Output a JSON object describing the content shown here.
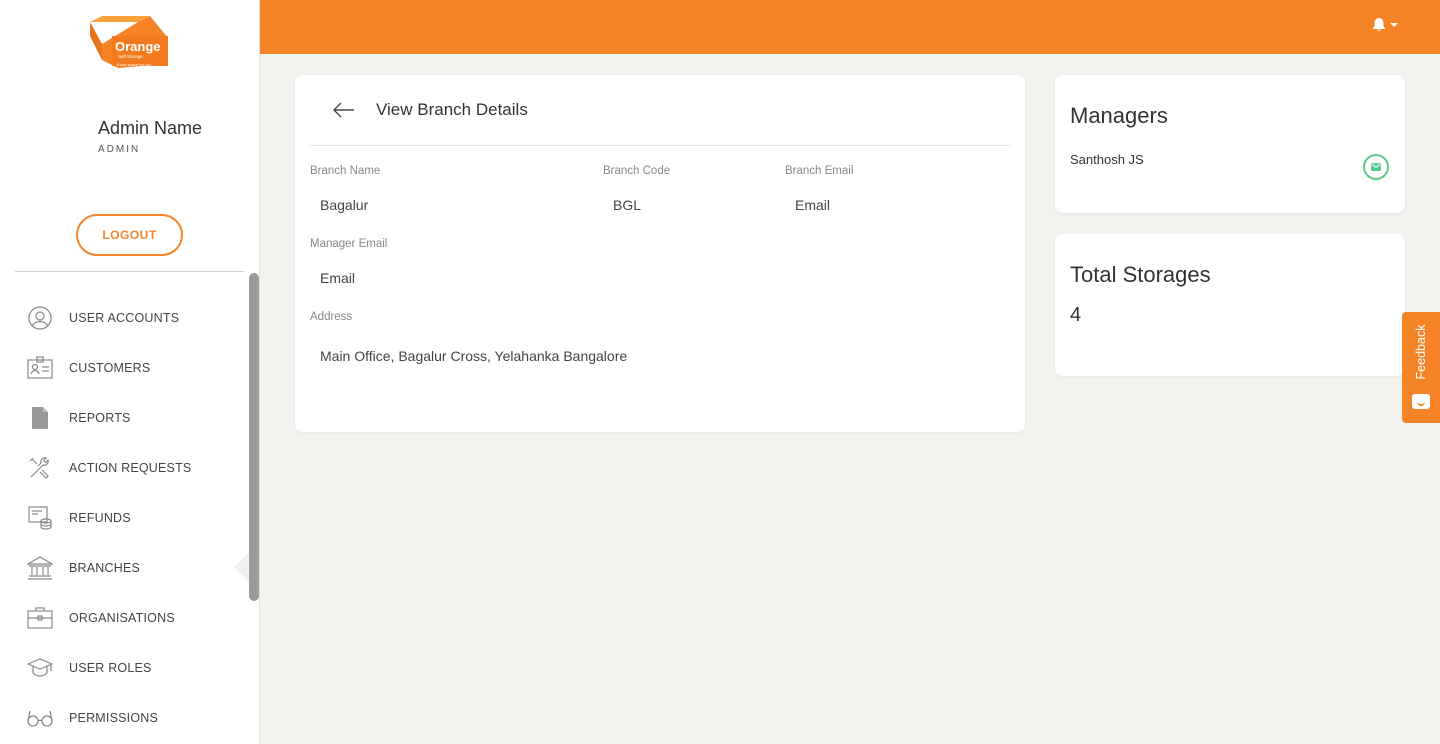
{
  "brand": {
    "logo_text": "Orange",
    "logo_subtext": "Self Storage",
    "logo_tagline": "Extra space for you",
    "accent_color": "#f58426"
  },
  "user": {
    "name": "Admin Name",
    "role": "ADMIN"
  },
  "sidebar": {
    "logout_label": "LOGOUT",
    "items": [
      {
        "label": "USER ACCOUNTS",
        "icon": "user-circle-icon"
      },
      {
        "label": "CUSTOMERS",
        "icon": "id-card-icon"
      },
      {
        "label": "REPORTS",
        "icon": "document-icon"
      },
      {
        "label": "ACTION REQUESTS",
        "icon": "tools-icon"
      },
      {
        "label": "REFUNDS",
        "icon": "refund-icon"
      },
      {
        "label": "BRANCHES",
        "icon": "bank-icon"
      },
      {
        "label": "ORGANISATIONS",
        "icon": "briefcase-icon"
      },
      {
        "label": "USER ROLES",
        "icon": "graduation-cap-icon"
      },
      {
        "label": "PERMISSIONS",
        "icon": "glasses-icon"
      }
    ],
    "active_item": "BRANCHES"
  },
  "header": {
    "notification_icon": "bell-icon"
  },
  "details": {
    "title": "View Branch Details",
    "fields": {
      "branch_name": {
        "label": "Branch Name",
        "value": "Bagalur"
      },
      "branch_code": {
        "label": "Branch Code",
        "value": "BGL"
      },
      "branch_email": {
        "label": "Branch Email",
        "value": "Email"
      },
      "manager_email": {
        "label": "Manager Email",
        "value": "Email"
      },
      "address": {
        "label": "Address",
        "value": "Main Office, Bagalur Cross, Yelahanka Bangalore"
      }
    }
  },
  "managers": {
    "title": "Managers",
    "list": [
      {
        "name": "Santhosh JS"
      }
    ]
  },
  "storages": {
    "title": "Total Storages",
    "count": "4"
  },
  "feedback": {
    "label": "Feedback"
  }
}
